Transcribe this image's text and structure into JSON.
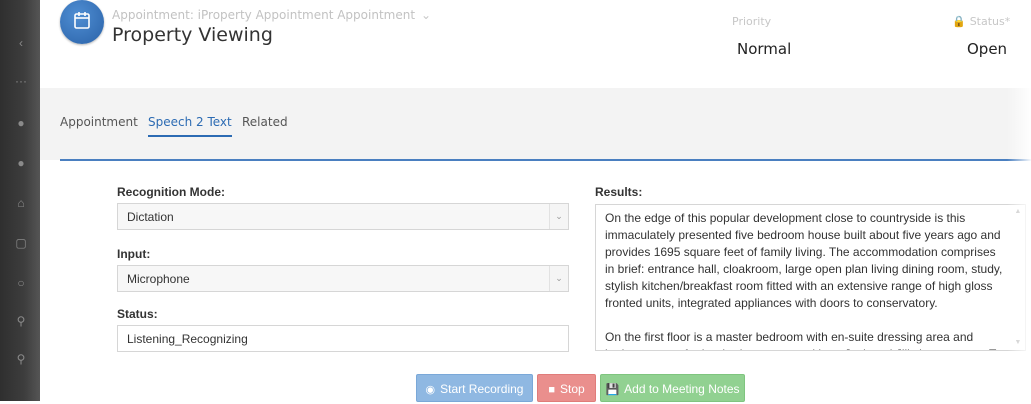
{
  "header": {
    "breadcrumb": "Appointment: iProperty Appointment Appointment",
    "title": "Property Viewing",
    "priority_label": "Priority",
    "priority_value": "Normal",
    "status_label": "Status*",
    "status_value": "Open"
  },
  "tabs": [
    {
      "label": "Appointment",
      "active": false
    },
    {
      "label": "Speech 2 Text",
      "active": true
    },
    {
      "label": "Related",
      "active": false
    }
  ],
  "form": {
    "recognition_mode_label": "Recognition Mode:",
    "recognition_mode_value": "Dictation",
    "input_label": "Input:",
    "input_value": "Microphone",
    "status_label": "Status:",
    "status_value": "Listening_Recognizing",
    "results_label": "Results:",
    "results_paragraph_1": "On the edge of this popular development close to countryside is this immaculately presented five bedroom house built about five years ago and provides 1695 square feet of family living. The accommodation comprises in brief: entrance hall, cloakroom, large open plan living dining room, study, stylish kitchen/breakfast room fitted with an extensive range of high gloss fronted units, integrated appliances with doors to conservatory.",
    "results_paragraph_2": "On the first floor is a master bedroom with en-suite dressing area and bathroom, two further bedrooms served by a Jack and Jill shower room. To the second floor"
  },
  "buttons": {
    "start": "Start Recording",
    "stop": "Stop",
    "add": "Add to Meeting Notes"
  },
  "colors": {
    "accent": "#2c6bb3",
    "start_button": "#8fb8e2",
    "stop_button": "#ea8f8d",
    "add_button": "#91d191"
  }
}
